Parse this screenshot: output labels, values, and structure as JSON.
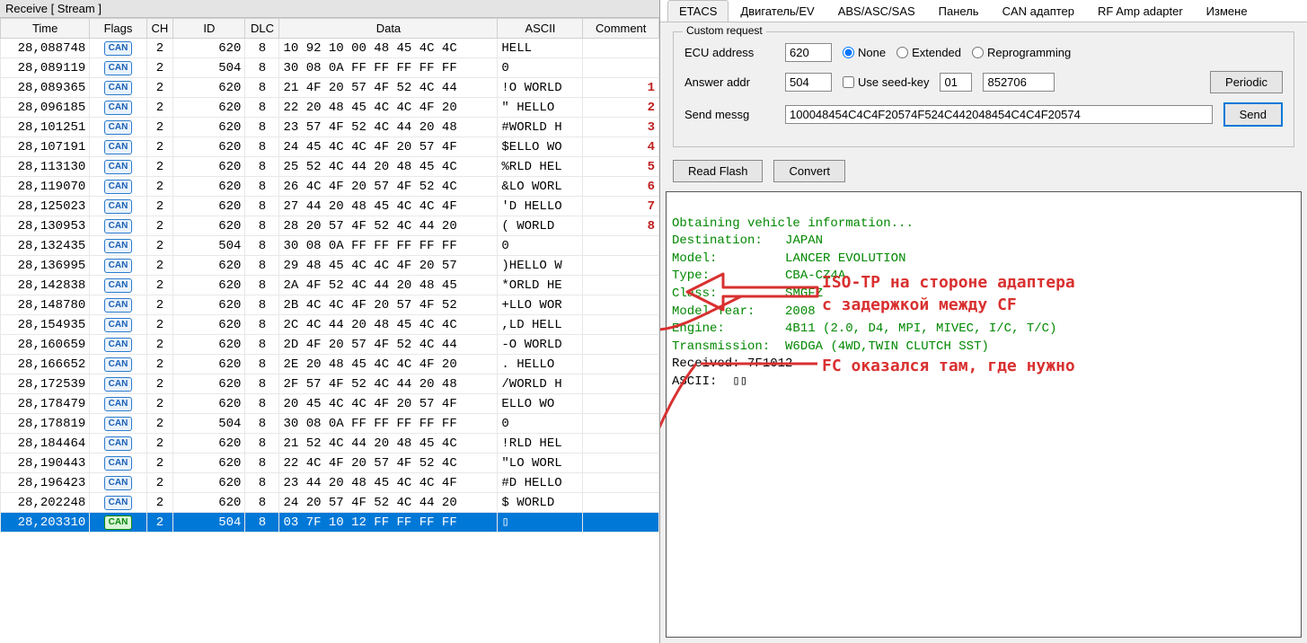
{
  "left_title": "Receive [ Stream ]",
  "columns": [
    "Time",
    "Flags",
    "CH",
    "ID",
    "DLC",
    "Data",
    "ASCII",
    "Comment"
  ],
  "can_label": "CAN",
  "rows": [
    {
      "time": "28,088748",
      "ch": "2",
      "id": "620",
      "dlc": "8",
      "data": "10 92 10 00 48 45 4C 4C",
      "ascii": "   HELL",
      "comment": ""
    },
    {
      "time": "28,089119",
      "ch": "2",
      "id": "504",
      "dlc": "8",
      "data": "30 08 0A FF FF FF FF FF",
      "ascii": "0",
      "comment": ""
    },
    {
      "time": "28,089365",
      "ch": "2",
      "id": "620",
      "dlc": "8",
      "data": "21 4F 20 57 4F 52 4C 44",
      "ascii": "!O WORLD",
      "comment": "1"
    },
    {
      "time": "28,096185",
      "ch": "2",
      "id": "620",
      "dlc": "8",
      "data": "22 20 48 45 4C 4C 4F 20",
      "ascii": "\" HELLO",
      "comment": "2"
    },
    {
      "time": "28,101251",
      "ch": "2",
      "id": "620",
      "dlc": "8",
      "data": "23 57 4F 52 4C 44 20 48",
      "ascii": "#WORLD H",
      "comment": "3"
    },
    {
      "time": "28,107191",
      "ch": "2",
      "id": "620",
      "dlc": "8",
      "data": "24 45 4C 4C 4F 20 57 4F",
      "ascii": "$ELLO WO",
      "comment": "4"
    },
    {
      "time": "28,113130",
      "ch": "2",
      "id": "620",
      "dlc": "8",
      "data": "25 52 4C 44 20 48 45 4C",
      "ascii": "%RLD HEL",
      "comment": "5"
    },
    {
      "time": "28,119070",
      "ch": "2",
      "id": "620",
      "dlc": "8",
      "data": "26 4C 4F 20 57 4F 52 4C",
      "ascii": "&LO WORL",
      "comment": "6"
    },
    {
      "time": "28,125023",
      "ch": "2",
      "id": "620",
      "dlc": "8",
      "data": "27 44 20 48 45 4C 4C 4F",
      "ascii": "'D HELLO",
      "comment": "7"
    },
    {
      "time": "28,130953",
      "ch": "2",
      "id": "620",
      "dlc": "8",
      "data": "28 20 57 4F 52 4C 44 20",
      "ascii": "( WORLD",
      "comment": "8"
    },
    {
      "time": "28,132435",
      "ch": "2",
      "id": "504",
      "dlc": "8",
      "data": "30 08 0A FF FF FF FF FF",
      "ascii": "0",
      "comment": ""
    },
    {
      "time": "28,136995",
      "ch": "2",
      "id": "620",
      "dlc": "8",
      "data": "29 48 45 4C 4C 4F 20 57",
      "ascii": ")HELLO W",
      "comment": ""
    },
    {
      "time": "28,142838",
      "ch": "2",
      "id": "620",
      "dlc": "8",
      "data": "2A 4F 52 4C 44 20 48 45",
      "ascii": "*ORLD HE",
      "comment": ""
    },
    {
      "time": "28,148780",
      "ch": "2",
      "id": "620",
      "dlc": "8",
      "data": "2B 4C 4C 4F 20 57 4F 52",
      "ascii": "+LLO WOR",
      "comment": ""
    },
    {
      "time": "28,154935",
      "ch": "2",
      "id": "620",
      "dlc": "8",
      "data": "2C 4C 44 20 48 45 4C 4C",
      "ascii": ",LD HELL",
      "comment": ""
    },
    {
      "time": "28,160659",
      "ch": "2",
      "id": "620",
      "dlc": "8",
      "data": "2D 4F 20 57 4F 52 4C 44",
      "ascii": "-O WORLD",
      "comment": ""
    },
    {
      "time": "28,166652",
      "ch": "2",
      "id": "620",
      "dlc": "8",
      "data": "2E 20 48 45 4C 4C 4F 20",
      "ascii": ". HELLO",
      "comment": ""
    },
    {
      "time": "28,172539",
      "ch": "2",
      "id": "620",
      "dlc": "8",
      "data": "2F 57 4F 52 4C 44 20 48",
      "ascii": "/WORLD H",
      "comment": ""
    },
    {
      "time": "28,178479",
      "ch": "2",
      "id": "620",
      "dlc": "8",
      "data": "20 45 4C 4C 4F 20 57 4F",
      "ascii": " ELLO WO",
      "comment": ""
    },
    {
      "time": "28,178819",
      "ch": "2",
      "id": "504",
      "dlc": "8",
      "data": "30 08 0A FF FF FF FF FF",
      "ascii": "0",
      "comment": ""
    },
    {
      "time": "28,184464",
      "ch": "2",
      "id": "620",
      "dlc": "8",
      "data": "21 52 4C 44 20 48 45 4C",
      "ascii": "!RLD HEL",
      "comment": ""
    },
    {
      "time": "28,190443",
      "ch": "2",
      "id": "620",
      "dlc": "8",
      "data": "22 4C 4F 20 57 4F 52 4C",
      "ascii": "\"LO WORL",
      "comment": ""
    },
    {
      "time": "28,196423",
      "ch": "2",
      "id": "620",
      "dlc": "8",
      "data": "23 44 20 48 45 4C 4C 4F",
      "ascii": "#D HELLO",
      "comment": ""
    },
    {
      "time": "28,202248",
      "ch": "2",
      "id": "620",
      "dlc": "8",
      "data": "24 20 57 4F 52 4C 44 20",
      "ascii": "$ WORLD",
      "comment": ""
    },
    {
      "time": "28,203310",
      "ch": "2",
      "id": "504",
      "dlc": "8",
      "data": "03 7F 10 12 FF FF FF FF",
      "ascii": "▯",
      "comment": "",
      "selected": true
    }
  ],
  "tabs": [
    "ETACS",
    "Двигатель/EV",
    "ABS/ASC/SAS",
    "Панель",
    "CAN адаптер",
    "RF Amp adapter",
    "Измене"
  ],
  "active_tab": 0,
  "custom_request": {
    "legend": "Custom request",
    "ecu_label": "ECU address",
    "ecu_value": "620",
    "radio_none": "None",
    "radio_ext": "Extended",
    "radio_reprog": "Reprogramming",
    "answer_label": "Answer addr",
    "answer_value": "504",
    "seedkey_label": "Use seed-key",
    "seedkey1": "01",
    "seedkey2": "852706",
    "periodic_btn": "Periodic",
    "send_label": "Send messg",
    "send_value": "100048454C4C4F20574F524C442048454C4C4F20574",
    "send_btn": "Send"
  },
  "btn_readflash": "Read Flash",
  "btn_convert": "Convert",
  "annot1": "ISO-TP на стороне адаптера\nс задержкой между CF",
  "annot2": "FC оказался там, где нужно",
  "terminal": {
    "line1": "Obtaining vehicle information...",
    "dest_lbl": "Destination:",
    "dest_val": "JAPAN",
    "model_lbl": "Model:",
    "model_val": "LANCER EVOLUTION",
    "type_lbl": "Type:",
    "type_val": "CBA-CZ4A",
    "class_lbl": "Class:",
    "class_val": "SMGFZ",
    "year_lbl": "Model Year:",
    "year_val": "2008",
    "engine_lbl": "Engine:",
    "engine_val": "4B11 (2.0, D4, MPI, MIVEC, I/C, T/C)",
    "trans_lbl": "Transmission:",
    "trans_val": "W6DGA (4WD,TWIN CLUTCH SST)",
    "recv": "Received: 7F1012",
    "ascii": "ASCII:  ▯▯"
  }
}
